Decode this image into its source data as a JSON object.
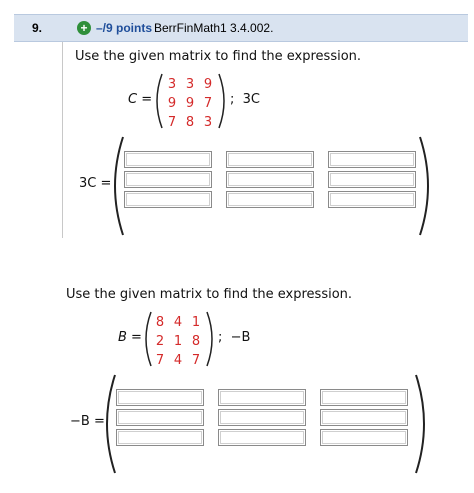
{
  "header": {
    "question_number": "9.",
    "points": "–/9 points",
    "source": "BerrFinMath1 3.4.002."
  },
  "problems": [
    {
      "prompt": "Use the given matrix to find the expression.",
      "matrix_name": "C",
      "matrix": [
        [
          "3",
          "3",
          "9"
        ],
        [
          "9",
          "9",
          "7"
        ],
        [
          "7",
          "8",
          "3"
        ]
      ],
      "expression": "3C",
      "answer_label": "3C",
      "answers": [
        [
          "",
          "",
          ""
        ],
        [
          "",
          "",
          ""
        ],
        [
          "",
          "",
          ""
        ]
      ]
    },
    {
      "prompt": "Use the given matrix to find the expression.",
      "matrix_name": "B",
      "matrix": [
        [
          "8",
          "4",
          "1"
        ],
        [
          "2",
          "1",
          "8"
        ],
        [
          "7",
          "4",
          "7"
        ]
      ],
      "expression": "−B",
      "answer_label": "−B",
      "answers": [
        [
          "",
          "",
          ""
        ],
        [
          "",
          "",
          ""
        ],
        [
          "",
          "",
          ""
        ]
      ]
    }
  ],
  "colors": {
    "matrix_entry": "#d42a2a",
    "header_bg": "#d9e3f0",
    "points": "#1f4e9a"
  }
}
